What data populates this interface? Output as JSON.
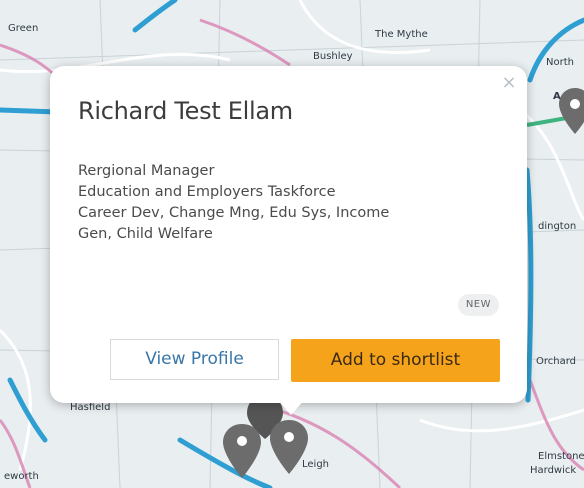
{
  "map": {
    "labels": {
      "green": "Green",
      "the_mythe": "The Mythe",
      "bushley": "Bushley",
      "north": "North",
      "dington": "dington",
      "orchard": "Orchard",
      "hasfield": "Hasfield",
      "leigh": "Leigh",
      "elmstone": "Elmstone",
      "hardwick": "Hardwick",
      "eworth": "eworth",
      "road_a": "A"
    },
    "colors": {
      "land": "#e9eef0",
      "motorway": "#2f9fd3",
      "a_road": "#d882b2",
      "green_road": "#3fb37f",
      "marker": "#6c6c6c"
    }
  },
  "popup": {
    "name": "Richard Test Ellam",
    "details": [
      "Rergional Manager",
      "Education and Employers Taskforce",
      "Career Dev, Change Mng, Edu Sys, Income",
      "Gen, Child Welfare"
    ],
    "badge": "NEW",
    "close_icon": "close-icon",
    "view_profile_label": "View Profile",
    "shortlist_label": "Add to shortlist"
  }
}
